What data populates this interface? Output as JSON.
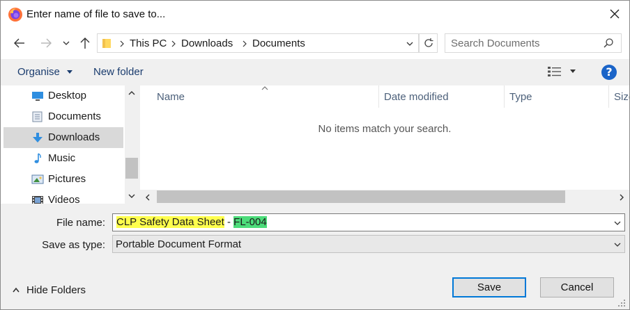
{
  "window": {
    "title": "Enter name of file to save to...",
    "app_icon": "firefox-icon"
  },
  "address": {
    "crumbs": [
      "This PC",
      "Downloads",
      "Documents"
    ],
    "search_placeholder": "Search Documents"
  },
  "toolbar": {
    "organise_label": "Organise",
    "new_folder_label": "New folder",
    "help_label": "?"
  },
  "nav": {
    "items": [
      {
        "label": "Desktop",
        "icon": "desktop-icon"
      },
      {
        "label": "Documents",
        "icon": "documents-icon"
      },
      {
        "label": "Downloads",
        "icon": "downloads-icon",
        "selected": true
      },
      {
        "label": "Music",
        "icon": "music-icon"
      },
      {
        "label": "Pictures",
        "icon": "pictures-icon"
      },
      {
        "label": "Videos",
        "icon": "videos-icon"
      }
    ]
  },
  "filelist": {
    "columns": [
      "Name",
      "Date modified",
      "Type",
      "Size"
    ],
    "empty_message": "No items match your search."
  },
  "form": {
    "file_name_label": "File name:",
    "file_name_part1": "CLP Safety Data Sheet",
    "file_name_sep": " - ",
    "file_name_part2": "FL-004",
    "save_type_label": "Save as type:",
    "save_type_value": "Portable Document Format"
  },
  "footer": {
    "hide_folders_label": "Hide Folders",
    "save_label": "Save",
    "cancel_label": "Cancel"
  },
  "colors": {
    "accent": "#0078d7",
    "highlight_yellow": "#ffff4d",
    "highlight_green": "#4cdc7a",
    "selection": "#d9d9d9"
  }
}
